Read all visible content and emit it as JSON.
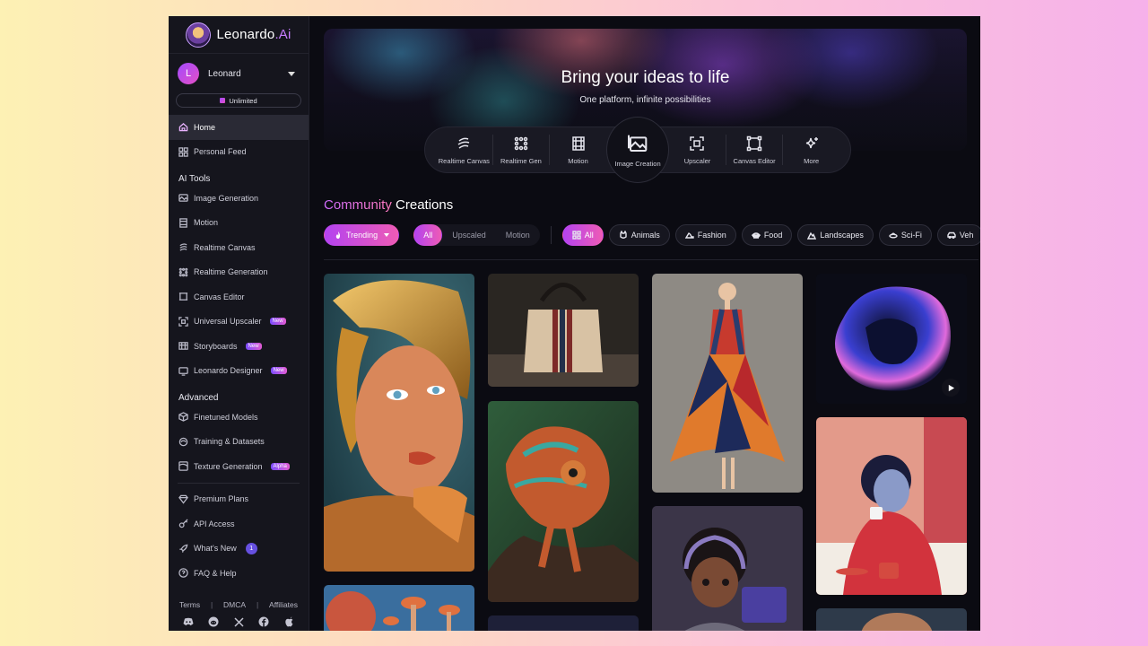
{
  "brand": {
    "name": "Leonardo",
    "suffix": ".Ai"
  },
  "user": {
    "initial": "L",
    "name": "Leonard",
    "plan": "Unlimited"
  },
  "sidebar": {
    "nav": [
      {
        "label": "Home",
        "icon": "home-icon"
      },
      {
        "label": "Personal Feed",
        "icon": "grid-icon"
      }
    ],
    "ai_tools_label": "AI Tools",
    "ai_tools": [
      {
        "label": "Image Generation",
        "icon": "image-icon"
      },
      {
        "label": "Motion",
        "icon": "film-icon"
      },
      {
        "label": "Realtime Canvas",
        "icon": "brush-icon"
      },
      {
        "label": "Realtime Generation",
        "icon": "dots-grid-icon"
      },
      {
        "label": "Canvas Editor",
        "icon": "crop-frame-icon"
      },
      {
        "label": "Universal Upscaler",
        "icon": "upscale-icon",
        "badge": "New"
      },
      {
        "label": "Storyboards",
        "icon": "storyboard-icon",
        "badge": "New"
      },
      {
        "label": "Leonardo Designer",
        "icon": "designer-icon",
        "badge": "New"
      }
    ],
    "advanced_label": "Advanced",
    "advanced": [
      {
        "label": "Finetuned Models",
        "icon": "cube-icon"
      },
      {
        "label": "Training & Datasets",
        "icon": "training-icon"
      },
      {
        "label": "Texture Generation",
        "icon": "texture-icon",
        "badge": "Alpha"
      }
    ],
    "more": [
      {
        "label": "Premium Plans",
        "icon": "diamond-icon"
      },
      {
        "label": "API Access",
        "icon": "key-icon"
      },
      {
        "label": "What's New",
        "icon": "rocket-icon",
        "count": "1"
      },
      {
        "label": "FAQ & Help",
        "icon": "help-icon"
      }
    ],
    "footer": {
      "terms": "Terms",
      "dmca": "DMCA",
      "affiliates": "Affiliates",
      "sep": "|"
    },
    "social": [
      "discord-icon",
      "reddit-icon",
      "x-icon",
      "facebook-icon",
      "apple-icon"
    ]
  },
  "hero": {
    "title": "Bring your ideas to life",
    "subtitle": "One platform, infinite possibilities"
  },
  "tools": [
    {
      "label": "Realtime Canvas",
      "icon": "realtime-canvas-icon"
    },
    {
      "label": "Realtime Gen",
      "icon": "realtime-gen-icon"
    },
    {
      "label": "Motion",
      "icon": "motion-icon"
    },
    {
      "label": "Image Creation",
      "icon": "image-creation-icon"
    },
    {
      "label": "Upscaler",
      "icon": "upscaler-icon"
    },
    {
      "label": "Canvas Editor",
      "icon": "canvas-editor-icon"
    },
    {
      "label": "More",
      "icon": "sparkles-icon"
    }
  ],
  "community": {
    "title_accent": "Community",
    "title_rest": " Creations",
    "sort": "Trending",
    "type_tabs": [
      "All",
      "Upscaled",
      "Motion"
    ],
    "categories": [
      {
        "label": "All",
        "icon": "grid-icon"
      },
      {
        "label": "Animals",
        "icon": "animals-icon"
      },
      {
        "label": "Fashion",
        "icon": "fashion-icon"
      },
      {
        "label": "Food",
        "icon": "food-icon"
      },
      {
        "label": "Landscapes",
        "icon": "landscape-icon"
      },
      {
        "label": "Sci-Fi",
        "icon": "scifi-icon"
      },
      {
        "label": "Veh",
        "icon": "vehicle-icon"
      }
    ]
  },
  "colors": {
    "accent_start": "#b443f0",
    "accent_end": "#ee5bb5",
    "bg": "#0b0b12",
    "sidebar": "#15151d"
  }
}
